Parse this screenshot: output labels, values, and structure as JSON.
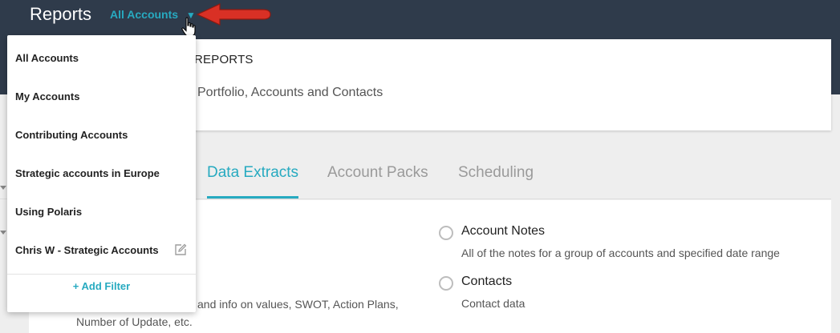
{
  "header": {
    "title": "Reports",
    "account_filter": "All Accounts",
    "caret": "▼"
  },
  "report_card": {
    "title": "REPORTS",
    "description": "Portfolio, Accounts and Contacts"
  },
  "tabs": [
    {
      "label": "Data Extracts",
      "active": true
    },
    {
      "label": "Account Packs",
      "active": false
    },
    {
      "label": "Scheduling",
      "active": false
    }
  ],
  "options": [
    {
      "label": "Account Notes",
      "description": "All of the notes for a group of accounts and specified date range"
    },
    {
      "label": "Contacts",
      "description": "Contact data"
    }
  ],
  "left_option_desc": {
    "line1": "and info on values, SWOT, Action Plans,",
    "line2": "Number of Update, etc."
  },
  "dropdown": {
    "items": [
      {
        "label": "All Accounts"
      },
      {
        "label": "My Accounts"
      },
      {
        "label": "Contributing Accounts"
      },
      {
        "label": "Strategic accounts in Europe"
      },
      {
        "label": "Using Polaris"
      },
      {
        "label": "Chris W - Strategic Accounts",
        "editable": true
      }
    ],
    "add_filter": "+ Add Filter"
  },
  "icons": {
    "edit": "edit-icon",
    "pointer": "red-arrow-pointer",
    "cursor": "hand-cursor-icon"
  },
  "colors": {
    "topbar": "#2f3b4b",
    "accent": "#27aac0",
    "arrow": "#d93025"
  }
}
